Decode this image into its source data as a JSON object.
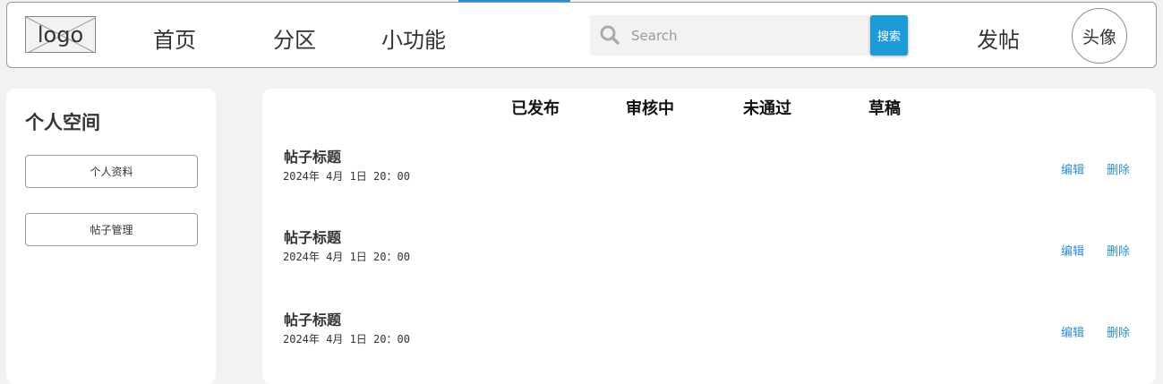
{
  "header": {
    "logo_text": "logo",
    "nav": [
      "首页",
      "分区",
      "小功能"
    ],
    "search_placeholder": "Search",
    "search_button": "搜索",
    "post_button": "发帖",
    "avatar_text": "头像"
  },
  "sidebar": {
    "title": "个人空间",
    "items": [
      "个人资料",
      "帖子管理"
    ]
  },
  "main": {
    "tabs": [
      "已发布",
      "审核中",
      "未通过",
      "草稿"
    ],
    "posts": [
      {
        "title": "帖子标题",
        "date": "2024年 4月 1日 20：00",
        "edit": "编辑",
        "delete": "删除"
      },
      {
        "title": "帖子标题",
        "date": "2024年 4月 1日 20：00",
        "edit": "编辑",
        "delete": "删除"
      },
      {
        "title": "帖子标题",
        "date": "2024年 4月 1日 20：00",
        "edit": "编辑",
        "delete": "删除"
      }
    ]
  },
  "colors": {
    "accent": "#1e9bd7",
    "link": "#2d8fd0",
    "background": "#f2f2f2"
  }
}
